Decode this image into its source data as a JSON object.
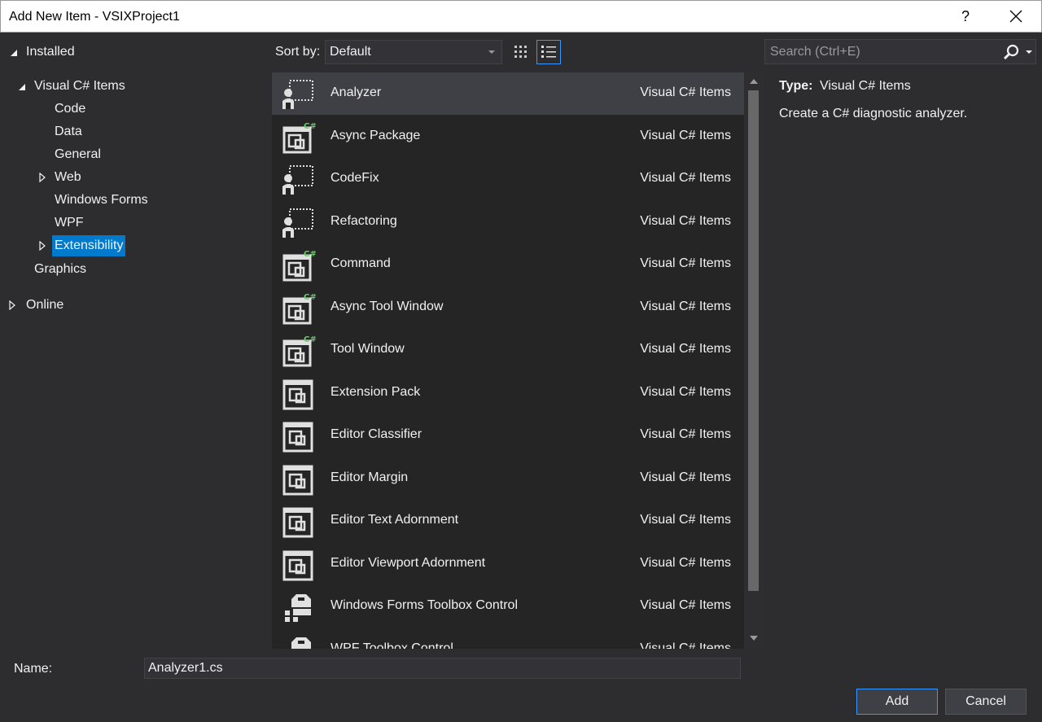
{
  "window": {
    "title": "Add New Item - VSIXProject1",
    "help_label": "?"
  },
  "tree": {
    "installed": "Installed",
    "visual_csharp": "Visual C# Items",
    "children": [
      "Code",
      "Data",
      "General",
      "Web",
      "Windows Forms",
      "WPF",
      "Extensibility"
    ],
    "graphics": "Graphics",
    "online": "Online"
  },
  "toolbar": {
    "sort_label": "Sort by:",
    "sort_value": "Default"
  },
  "search": {
    "placeholder": "Search (Ctrl+E)"
  },
  "items": [
    {
      "name": "Analyzer",
      "category": "Visual C# Items",
      "icon": "analyzer-icon"
    },
    {
      "name": "Async Package",
      "category": "Visual C# Items",
      "icon": "csharp-extension-icon"
    },
    {
      "name": "CodeFix",
      "category": "Visual C# Items",
      "icon": "analyzer-icon"
    },
    {
      "name": "Refactoring",
      "category": "Visual C# Items",
      "icon": "analyzer-icon"
    },
    {
      "name": "Command",
      "category": "Visual C# Items",
      "icon": "csharp-extension-icon"
    },
    {
      "name": "Async Tool Window",
      "category": "Visual C# Items",
      "icon": "csharp-extension-icon"
    },
    {
      "name": "Tool Window",
      "category": "Visual C# Items",
      "icon": "csharp-extension-icon"
    },
    {
      "name": "Extension Pack",
      "category": "Visual C# Items",
      "icon": "extension-icon"
    },
    {
      "name": "Editor Classifier",
      "category": "Visual C# Items",
      "icon": "extension-icon"
    },
    {
      "name": "Editor Margin",
      "category": "Visual C# Items",
      "icon": "extension-icon"
    },
    {
      "name": "Editor Text Adornment",
      "category": "Visual C# Items",
      "icon": "extension-icon"
    },
    {
      "name": "Editor Viewport Adornment",
      "category": "Visual C# Items",
      "icon": "extension-icon"
    },
    {
      "name": "Windows Forms Toolbox Control",
      "category": "Visual C# Items",
      "icon": "toolbox-icon"
    },
    {
      "name": "WPF Toolbox Control",
      "category": "Visual C# Items",
      "icon": "toolbox-icon"
    }
  ],
  "details": {
    "type_label": "Type:",
    "type_value": "Visual C# Items",
    "description": "Create a C# diagnostic analyzer."
  },
  "bottom": {
    "name_label": "Name:",
    "name_value": "Analyzer1.cs",
    "add_label": "Add",
    "cancel_label": "Cancel"
  },
  "colors": {
    "accent": "#007acc",
    "background": "#2d2d30",
    "list_bg": "#252526",
    "selected_row": "#3f3f46",
    "csharp_badge": "#6ec86e"
  }
}
